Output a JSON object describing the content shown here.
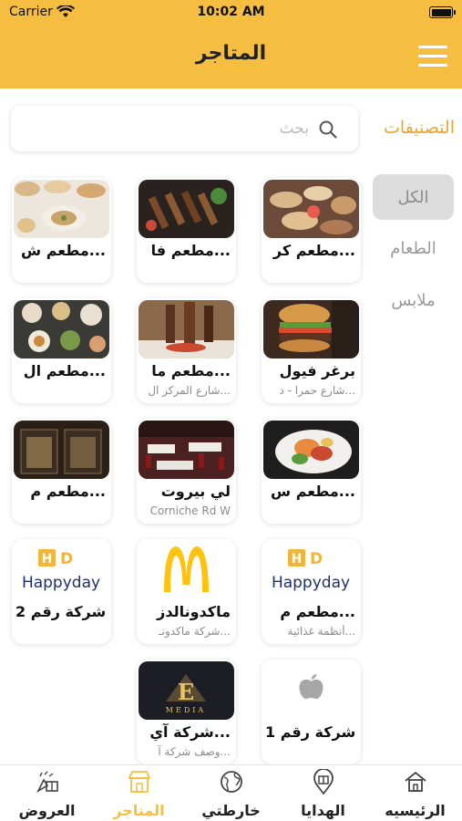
{
  "status": {
    "carrier": "Carrier",
    "time": "10:02 AM"
  },
  "header": {
    "title": "المتاجر"
  },
  "search": {
    "placeholder": "بحث"
  },
  "categories": {
    "title": "التصنيفات",
    "items": [
      {
        "label": "الكل",
        "active": true
      },
      {
        "label": "الطعام",
        "active": false
      },
      {
        "label": "ملابس",
        "active": false
      }
    ]
  },
  "stores": [
    {
      "name": "مطعم كر...",
      "sub": ""
    },
    {
      "name": "مطعم فا...",
      "sub": ""
    },
    {
      "name": "مطعم ش...",
      "sub": ""
    },
    {
      "name": "برغر فيول",
      "sub": "شارع حمرا - د..."
    },
    {
      "name": "مطعم ما...",
      "sub": "شارع المركز ال..."
    },
    {
      "name": "مطعم ال...",
      "sub": ""
    },
    {
      "name": "مطعم س...",
      "sub": ""
    },
    {
      "name": "لي بيروت",
      "sub": "Corniche Rd W"
    },
    {
      "name": "مطعم م...",
      "sub": ""
    },
    {
      "name": "مطعم م...",
      "sub": "أنظمة غذائية...",
      "logo_text": "Happyday"
    },
    {
      "name": "ماكدونالدز",
      "sub": "شركة ماكدونـ..."
    },
    {
      "name": "شركة رقم 2",
      "sub": "",
      "logo_text": "Happyday"
    },
    {
      "name": "شركة رقم 1",
      "sub": ""
    },
    {
      "name": "شركة آي...",
      "sub": "وصف شركة آ...",
      "logo_text": "MEDIA"
    }
  ],
  "tabs": [
    {
      "label": "الرئيسيه",
      "icon": "home-icon",
      "active": false
    },
    {
      "label": "الهدايا",
      "icon": "gift-pin-icon",
      "active": false
    },
    {
      "label": "خارطتي",
      "icon": "globe-icon",
      "active": false
    },
    {
      "label": "المتاجر",
      "icon": "store-icon",
      "active": true
    },
    {
      "label": "العروض",
      "icon": "offers-icon",
      "active": false
    }
  ],
  "colors": {
    "accent": "#F5BE40",
    "category_title": "#E8A630",
    "active_category_bg": "#DCDCDC"
  }
}
